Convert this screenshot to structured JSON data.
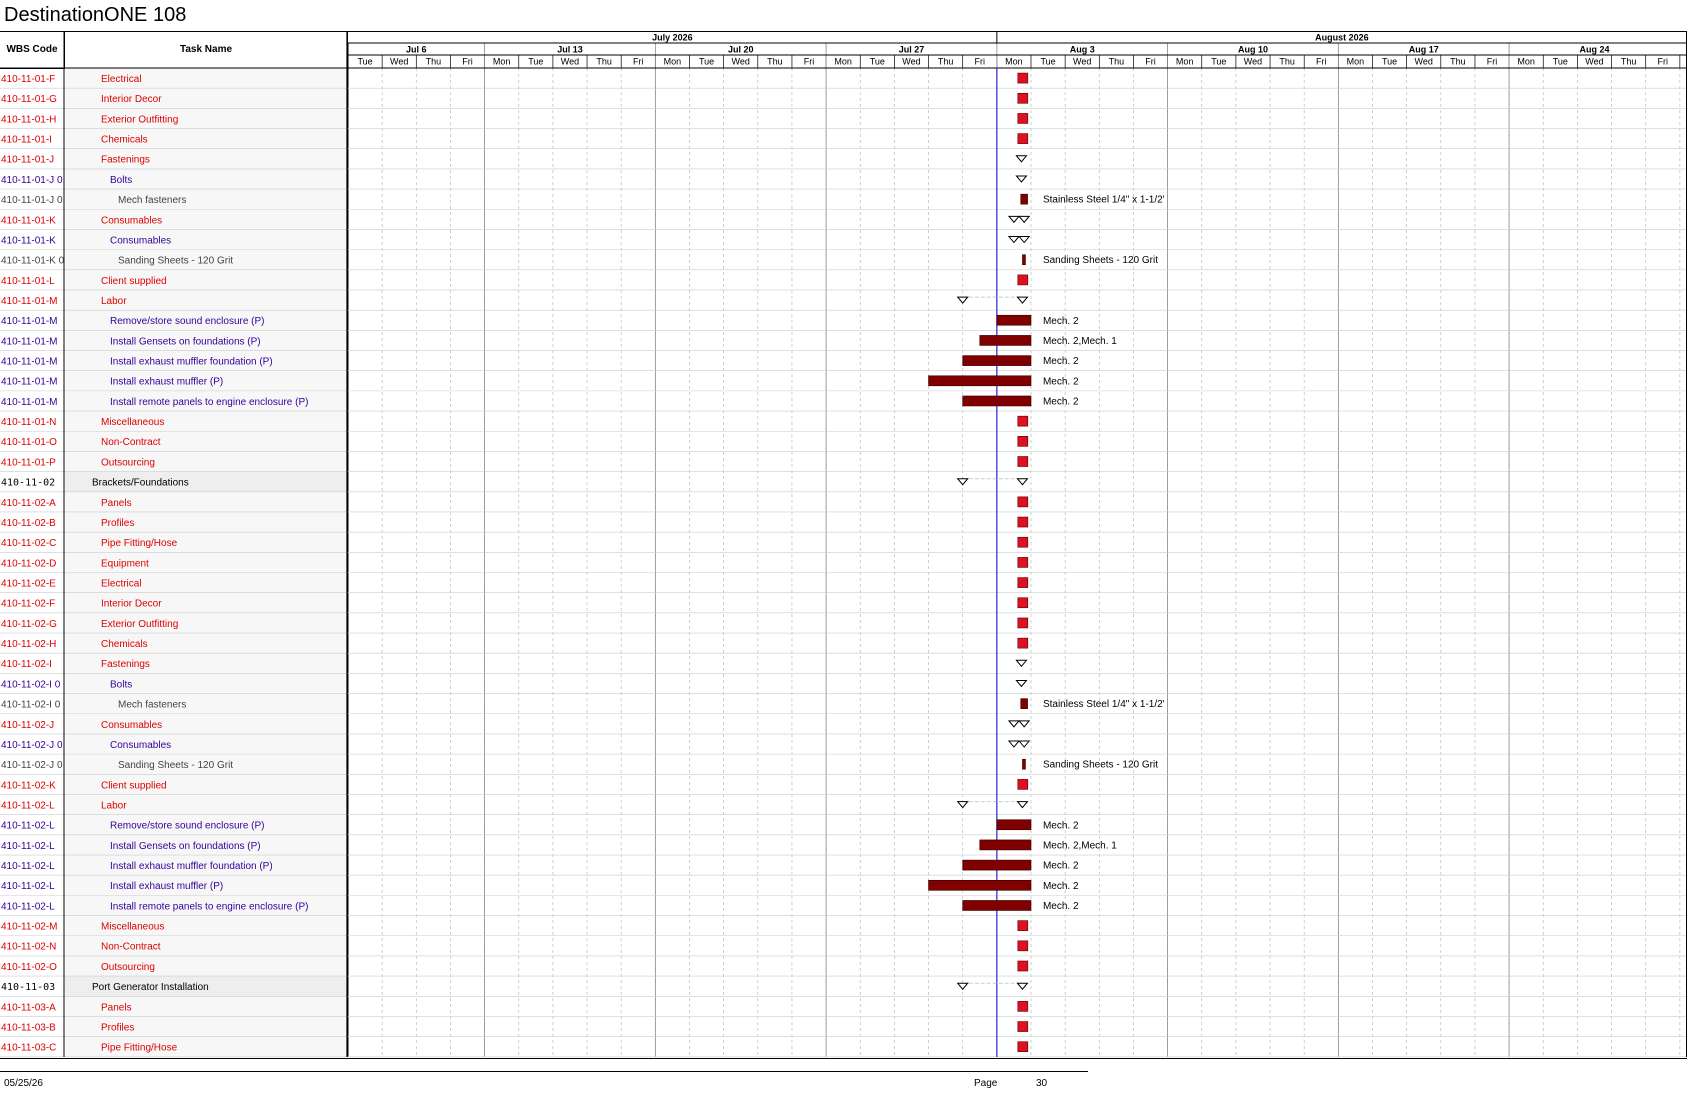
{
  "title": "DestinationONE 108",
  "columns": {
    "wbs": "WBS Code",
    "task": "Task Name"
  },
  "colors": {
    "red_text": "#dd0000",
    "purple_text": "#330099",
    "gray_text": "#444444",
    "milestone_fill": "#dd1122",
    "bar_fill": "#800000",
    "status_line": "#2b2bd6"
  },
  "timeline": {
    "months": [
      "July 2026",
      "August 2026"
    ],
    "weeks": [
      "Jul 6",
      "Jul 13",
      "Jul 20",
      "Jul 27",
      "Aug 3",
      "Aug 10",
      "Aug 17",
      "Aug 24"
    ],
    "days": [
      "Tue",
      "Wed",
      "Thu",
      "Fri",
      "Mon",
      "Tue",
      "Wed",
      "Thu",
      "Fri",
      "Mon",
      "Tue",
      "Wed",
      "Thu",
      "Fri",
      "Mon",
      "Tue",
      "Wed",
      "Thu",
      "Fri",
      "Mon",
      "Tue",
      "Wed",
      "Thu",
      "Fri",
      "Mon",
      "Tue",
      "Wed",
      "Thu",
      "Fri",
      "Mon",
      "Tue",
      "Wed",
      "Thu",
      "Fri",
      "Mon",
      "Tue",
      "Wed",
      "Thu",
      "Fri"
    ]
  },
  "rows": [
    {
      "wbs": "410-11-01-F",
      "task": "Electrical",
      "style": "red",
      "level": 1,
      "mark": "milestone"
    },
    {
      "wbs": "410-11-01-G",
      "task": "Interior Decor",
      "style": "red",
      "level": 1,
      "mark": "milestone"
    },
    {
      "wbs": "410-11-01-H",
      "task": "Exterior Outfitting",
      "style": "red",
      "level": 1,
      "mark": "milestone"
    },
    {
      "wbs": "410-11-01-I",
      "task": "Chemicals",
      "style": "red",
      "level": 1,
      "mark": "milestone"
    },
    {
      "wbs": "410-11-01-J",
      "task": "Fastenings",
      "style": "red",
      "level": 1,
      "mark": "summary"
    },
    {
      "wbs": "410-11-01-J 0",
      "task": "Bolts",
      "style": "purple",
      "level": 2,
      "mark": "summary"
    },
    {
      "wbs": "410-11-01-J 0",
      "task": "Mech fasteners",
      "style": "gray",
      "level": 3,
      "mark": "bar",
      "bar": [
        19.7,
        19.9
      ],
      "label": "Stainless Steel 1/4\" x 1-1/2'"
    },
    {
      "wbs": "410-11-01-K",
      "task": "Consumables",
      "style": "red",
      "level": 1,
      "mark": "summary2"
    },
    {
      "wbs": "410-11-01-K",
      "task": "Consumables",
      "style": "purple",
      "level": 2,
      "mark": "summary2"
    },
    {
      "wbs": "410-11-01-K 0",
      "task": "Sanding Sheets - 120 Grit",
      "style": "gray",
      "level": 3,
      "mark": "bar",
      "bar": [
        19.75,
        19.82
      ],
      "label": "Sanding Sheets - 120 Grit"
    },
    {
      "wbs": "410-11-01-L",
      "task": "Client supplied",
      "style": "red",
      "level": 1,
      "mark": "milestone"
    },
    {
      "wbs": "410-11-01-M",
      "task": "Labor",
      "style": "red",
      "level": 1,
      "mark": "summary-span",
      "span": [
        18.0,
        19.75
      ]
    },
    {
      "wbs": "410-11-01-M",
      "task": "Remove/store sound enclosure (P)",
      "style": "purple",
      "level": 2,
      "mark": "bar",
      "bar": [
        19.0,
        20.0
      ],
      "label": "Mech. 2"
    },
    {
      "wbs": "410-11-01-M",
      "task": "Install Gensets on foundations (P)",
      "style": "purple",
      "level": 2,
      "mark": "bar",
      "bar": [
        18.5,
        20.0
      ],
      "label": "Mech. 2,Mech. 1"
    },
    {
      "wbs": "410-11-01-M",
      "task": "Install exhaust muffler foundation (P)",
      "style": "purple",
      "level": 2,
      "mark": "bar",
      "bar": [
        18.0,
        20.0
      ],
      "label": "Mech. 2"
    },
    {
      "wbs": "410-11-01-M",
      "task": "Install exhaust muffler (P)",
      "style": "purple",
      "level": 2,
      "mark": "bar",
      "bar": [
        17.0,
        20.0
      ],
      "label": "Mech. 2"
    },
    {
      "wbs": "410-11-01-M",
      "task": "Install remote panels to engine enclosure (P)",
      "style": "purple",
      "level": 2,
      "mark": "bar",
      "bar": [
        18.0,
        20.0
      ],
      "label": "Mech. 2"
    },
    {
      "wbs": "410-11-01-N",
      "task": "Miscellaneous",
      "style": "red",
      "level": 1,
      "mark": "milestone"
    },
    {
      "wbs": "410-11-01-O",
      "task": "Non-Contract",
      "style": "red",
      "level": 1,
      "mark": "milestone"
    },
    {
      "wbs": "410-11-01-P",
      "task": "Outsourcing",
      "style": "red",
      "level": 1,
      "mark": "milestone"
    },
    {
      "wbs": "410-11-02",
      "task": "Brackets/Foundations",
      "style": "black",
      "level": 0,
      "mark": "summary-span",
      "span": [
        18.0,
        19.75
      ]
    },
    {
      "wbs": "410-11-02-A",
      "task": "Panels",
      "style": "red",
      "level": 1,
      "mark": "milestone"
    },
    {
      "wbs": "410-11-02-B",
      "task": "Profiles",
      "style": "red",
      "level": 1,
      "mark": "milestone"
    },
    {
      "wbs": "410-11-02-C",
      "task": "Pipe Fitting/Hose",
      "style": "red",
      "level": 1,
      "mark": "milestone"
    },
    {
      "wbs": "410-11-02-D",
      "task": "Equipment",
      "style": "red",
      "level": 1,
      "mark": "milestone"
    },
    {
      "wbs": "410-11-02-E",
      "task": "Electrical",
      "style": "red",
      "level": 1,
      "mark": "milestone"
    },
    {
      "wbs": "410-11-02-F",
      "task": "Interior Decor",
      "style": "red",
      "level": 1,
      "mark": "milestone"
    },
    {
      "wbs": "410-11-02-G",
      "task": "Exterior Outfitting",
      "style": "red",
      "level": 1,
      "mark": "milestone"
    },
    {
      "wbs": "410-11-02-H",
      "task": "Chemicals",
      "style": "red",
      "level": 1,
      "mark": "milestone"
    },
    {
      "wbs": "410-11-02-I",
      "task": "Fastenings",
      "style": "red",
      "level": 1,
      "mark": "summary"
    },
    {
      "wbs": "410-11-02-I 0",
      "task": "Bolts",
      "style": "purple",
      "level": 2,
      "mark": "summary"
    },
    {
      "wbs": "410-11-02-I 0",
      "task": "Mech fasteners",
      "style": "gray",
      "level": 3,
      "mark": "bar",
      "bar": [
        19.7,
        19.9
      ],
      "label": "Stainless Steel 1/4\" x 1-1/2'"
    },
    {
      "wbs": "410-11-02-J",
      "task": "Consumables",
      "style": "red",
      "level": 1,
      "mark": "summary2"
    },
    {
      "wbs": "410-11-02-J 0",
      "task": "Consumables",
      "style": "purple",
      "level": 2,
      "mark": "summary2"
    },
    {
      "wbs": "410-11-02-J 0",
      "task": "Sanding Sheets - 120 Grit",
      "style": "gray",
      "level": 3,
      "mark": "bar",
      "bar": [
        19.75,
        19.82
      ],
      "label": "Sanding Sheets - 120 Grit"
    },
    {
      "wbs": "410-11-02-K",
      "task": "Client supplied",
      "style": "red",
      "level": 1,
      "mark": "milestone"
    },
    {
      "wbs": "410-11-02-L",
      "task": "Labor",
      "style": "red",
      "level": 1,
      "mark": "summary-span",
      "span": [
        18.0,
        19.75
      ]
    },
    {
      "wbs": "410-11-02-L",
      "task": "Remove/store sound enclosure (P)",
      "style": "purple",
      "level": 2,
      "mark": "bar",
      "bar": [
        19.0,
        20.0
      ],
      "label": "Mech. 2"
    },
    {
      "wbs": "410-11-02-L",
      "task": "Install Gensets on foundations (P)",
      "style": "purple",
      "level": 2,
      "mark": "bar",
      "bar": [
        18.5,
        20.0
      ],
      "label": "Mech. 2,Mech. 1"
    },
    {
      "wbs": "410-11-02-L",
      "task": "Install exhaust muffler foundation (P)",
      "style": "purple",
      "level": 2,
      "mark": "bar",
      "bar": [
        18.0,
        20.0
      ],
      "label": "Mech. 2"
    },
    {
      "wbs": "410-11-02-L",
      "task": "Install exhaust muffler (P)",
      "style": "purple",
      "level": 2,
      "mark": "bar",
      "bar": [
        17.0,
        20.0
      ],
      "label": "Mech. 2"
    },
    {
      "wbs": "410-11-02-L",
      "task": "Install remote panels to engine enclosure (P)",
      "style": "purple",
      "level": 2,
      "mark": "bar",
      "bar": [
        18.0,
        20.0
      ],
      "label": "Mech. 2"
    },
    {
      "wbs": "410-11-02-M",
      "task": "Miscellaneous",
      "style": "red",
      "level": 1,
      "mark": "milestone"
    },
    {
      "wbs": "410-11-02-N",
      "task": "Non-Contract",
      "style": "red",
      "level": 1,
      "mark": "milestone"
    },
    {
      "wbs": "410-11-02-O",
      "task": "Outsourcing",
      "style": "red",
      "level": 1,
      "mark": "milestone"
    },
    {
      "wbs": "410-11-03",
      "task": "Port Generator Installation",
      "style": "black",
      "level": 0,
      "mark": "summary-span",
      "span": [
        18.0,
        19.75
      ]
    },
    {
      "wbs": "410-11-03-A",
      "task": "Panels",
      "style": "red",
      "level": 1,
      "mark": "milestone"
    },
    {
      "wbs": "410-11-03-B",
      "task": "Profiles",
      "style": "red",
      "level": 1,
      "mark": "milestone"
    },
    {
      "wbs": "410-11-03-C",
      "task": "Pipe Fitting/Hose",
      "style": "red",
      "level": 1,
      "mark": "milestone"
    }
  ],
  "footer": {
    "date": "05/25/26",
    "page_label": "Page",
    "page_number": "30"
  }
}
